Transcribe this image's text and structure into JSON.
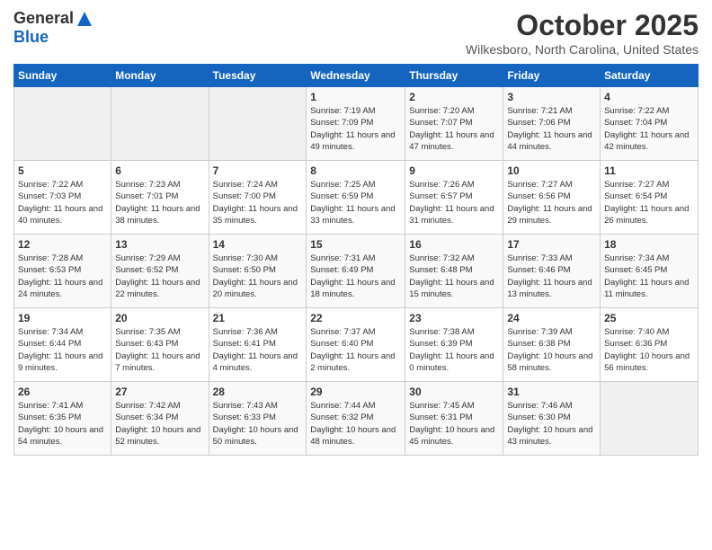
{
  "logo": {
    "general": "General",
    "blue": "Blue"
  },
  "header": {
    "month": "October 2025",
    "location": "Wilkesboro, North Carolina, United States"
  },
  "weekdays": [
    "Sunday",
    "Monday",
    "Tuesday",
    "Wednesday",
    "Thursday",
    "Friday",
    "Saturday"
  ],
  "weeks": [
    [
      {
        "day": "",
        "sunrise": "",
        "sunset": "",
        "daylight": ""
      },
      {
        "day": "",
        "sunrise": "",
        "sunset": "",
        "daylight": ""
      },
      {
        "day": "",
        "sunrise": "",
        "sunset": "",
        "daylight": ""
      },
      {
        "day": "1",
        "sunrise": "Sunrise: 7:19 AM",
        "sunset": "Sunset: 7:09 PM",
        "daylight": "Daylight: 11 hours and 49 minutes."
      },
      {
        "day": "2",
        "sunrise": "Sunrise: 7:20 AM",
        "sunset": "Sunset: 7:07 PM",
        "daylight": "Daylight: 11 hours and 47 minutes."
      },
      {
        "day": "3",
        "sunrise": "Sunrise: 7:21 AM",
        "sunset": "Sunset: 7:06 PM",
        "daylight": "Daylight: 11 hours and 44 minutes."
      },
      {
        "day": "4",
        "sunrise": "Sunrise: 7:22 AM",
        "sunset": "Sunset: 7:04 PM",
        "daylight": "Daylight: 11 hours and 42 minutes."
      }
    ],
    [
      {
        "day": "5",
        "sunrise": "Sunrise: 7:22 AM",
        "sunset": "Sunset: 7:03 PM",
        "daylight": "Daylight: 11 hours and 40 minutes."
      },
      {
        "day": "6",
        "sunrise": "Sunrise: 7:23 AM",
        "sunset": "Sunset: 7:01 PM",
        "daylight": "Daylight: 11 hours and 38 minutes."
      },
      {
        "day": "7",
        "sunrise": "Sunrise: 7:24 AM",
        "sunset": "Sunset: 7:00 PM",
        "daylight": "Daylight: 11 hours and 35 minutes."
      },
      {
        "day": "8",
        "sunrise": "Sunrise: 7:25 AM",
        "sunset": "Sunset: 6:59 PM",
        "daylight": "Daylight: 11 hours and 33 minutes."
      },
      {
        "day": "9",
        "sunrise": "Sunrise: 7:26 AM",
        "sunset": "Sunset: 6:57 PM",
        "daylight": "Daylight: 11 hours and 31 minutes."
      },
      {
        "day": "10",
        "sunrise": "Sunrise: 7:27 AM",
        "sunset": "Sunset: 6:56 PM",
        "daylight": "Daylight: 11 hours and 29 minutes."
      },
      {
        "day": "11",
        "sunrise": "Sunrise: 7:27 AM",
        "sunset": "Sunset: 6:54 PM",
        "daylight": "Daylight: 11 hours and 26 minutes."
      }
    ],
    [
      {
        "day": "12",
        "sunrise": "Sunrise: 7:28 AM",
        "sunset": "Sunset: 6:53 PM",
        "daylight": "Daylight: 11 hours and 24 minutes."
      },
      {
        "day": "13",
        "sunrise": "Sunrise: 7:29 AM",
        "sunset": "Sunset: 6:52 PM",
        "daylight": "Daylight: 11 hours and 22 minutes."
      },
      {
        "day": "14",
        "sunrise": "Sunrise: 7:30 AM",
        "sunset": "Sunset: 6:50 PM",
        "daylight": "Daylight: 11 hours and 20 minutes."
      },
      {
        "day": "15",
        "sunrise": "Sunrise: 7:31 AM",
        "sunset": "Sunset: 6:49 PM",
        "daylight": "Daylight: 11 hours and 18 minutes."
      },
      {
        "day": "16",
        "sunrise": "Sunrise: 7:32 AM",
        "sunset": "Sunset: 6:48 PM",
        "daylight": "Daylight: 11 hours and 15 minutes."
      },
      {
        "day": "17",
        "sunrise": "Sunrise: 7:33 AM",
        "sunset": "Sunset: 6:46 PM",
        "daylight": "Daylight: 11 hours and 13 minutes."
      },
      {
        "day": "18",
        "sunrise": "Sunrise: 7:34 AM",
        "sunset": "Sunset: 6:45 PM",
        "daylight": "Daylight: 11 hours and 11 minutes."
      }
    ],
    [
      {
        "day": "19",
        "sunrise": "Sunrise: 7:34 AM",
        "sunset": "Sunset: 6:44 PM",
        "daylight": "Daylight: 11 hours and 9 minutes."
      },
      {
        "day": "20",
        "sunrise": "Sunrise: 7:35 AM",
        "sunset": "Sunset: 6:43 PM",
        "daylight": "Daylight: 11 hours and 7 minutes."
      },
      {
        "day": "21",
        "sunrise": "Sunrise: 7:36 AM",
        "sunset": "Sunset: 6:41 PM",
        "daylight": "Daylight: 11 hours and 4 minutes."
      },
      {
        "day": "22",
        "sunrise": "Sunrise: 7:37 AM",
        "sunset": "Sunset: 6:40 PM",
        "daylight": "Daylight: 11 hours and 2 minutes."
      },
      {
        "day": "23",
        "sunrise": "Sunrise: 7:38 AM",
        "sunset": "Sunset: 6:39 PM",
        "daylight": "Daylight: 11 hours and 0 minutes."
      },
      {
        "day": "24",
        "sunrise": "Sunrise: 7:39 AM",
        "sunset": "Sunset: 6:38 PM",
        "daylight": "Daylight: 10 hours and 58 minutes."
      },
      {
        "day": "25",
        "sunrise": "Sunrise: 7:40 AM",
        "sunset": "Sunset: 6:36 PM",
        "daylight": "Daylight: 10 hours and 56 minutes."
      }
    ],
    [
      {
        "day": "26",
        "sunrise": "Sunrise: 7:41 AM",
        "sunset": "Sunset: 6:35 PM",
        "daylight": "Daylight: 10 hours and 54 minutes."
      },
      {
        "day": "27",
        "sunrise": "Sunrise: 7:42 AM",
        "sunset": "Sunset: 6:34 PM",
        "daylight": "Daylight: 10 hours and 52 minutes."
      },
      {
        "day": "28",
        "sunrise": "Sunrise: 7:43 AM",
        "sunset": "Sunset: 6:33 PM",
        "daylight": "Daylight: 10 hours and 50 minutes."
      },
      {
        "day": "29",
        "sunrise": "Sunrise: 7:44 AM",
        "sunset": "Sunset: 6:32 PM",
        "daylight": "Daylight: 10 hours and 48 minutes."
      },
      {
        "day": "30",
        "sunrise": "Sunrise: 7:45 AM",
        "sunset": "Sunset: 6:31 PM",
        "daylight": "Daylight: 10 hours and 45 minutes."
      },
      {
        "day": "31",
        "sunrise": "Sunrise: 7:46 AM",
        "sunset": "Sunset: 6:30 PM",
        "daylight": "Daylight: 10 hours and 43 minutes."
      },
      {
        "day": "",
        "sunrise": "",
        "sunset": "",
        "daylight": ""
      }
    ]
  ]
}
